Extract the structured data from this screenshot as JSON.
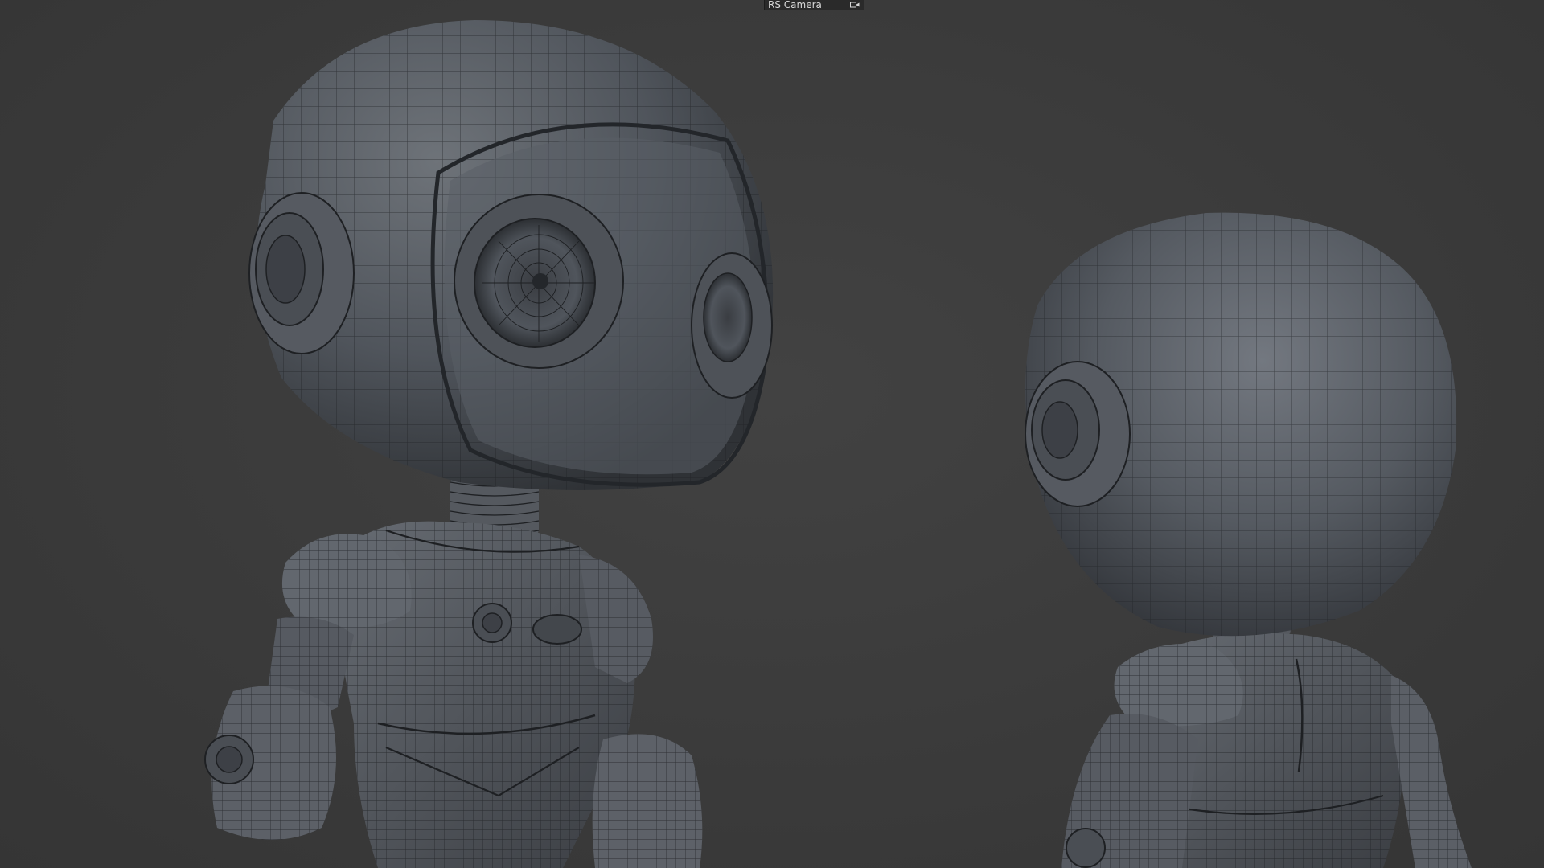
{
  "viewport": {
    "camera": {
      "label": "RS Camera",
      "icon": "camera-icon"
    }
  },
  "colors": {
    "background": "#3b3b3b",
    "model_shade": "#5a5f66",
    "wire": "#1e2023"
  }
}
